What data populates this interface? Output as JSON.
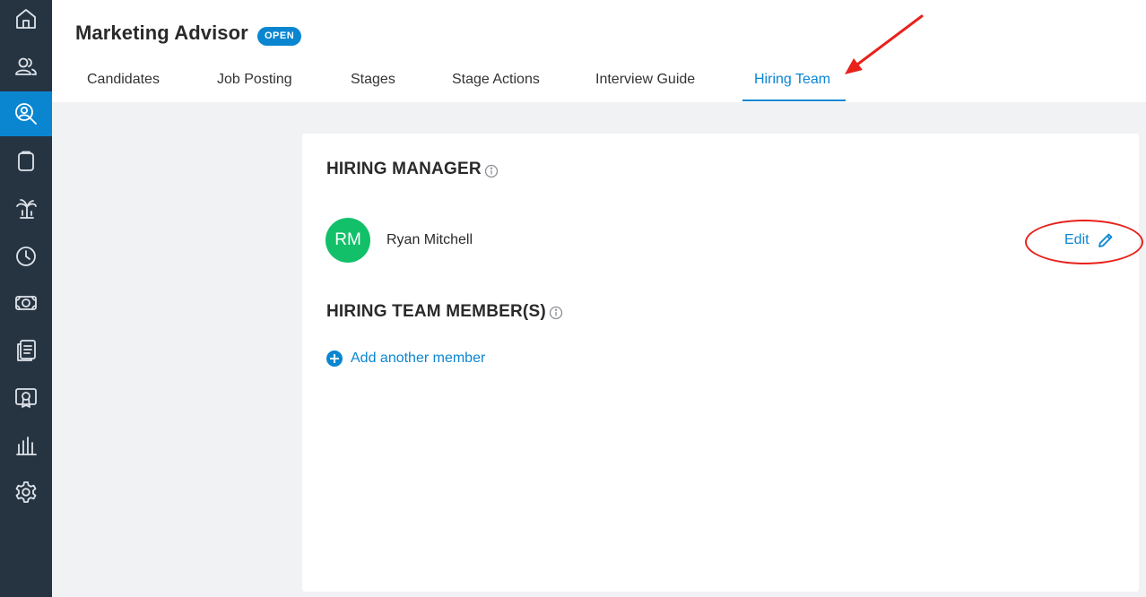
{
  "sidebar": {
    "items": [
      {
        "icon": "home-icon",
        "active": false
      },
      {
        "icon": "people-icon",
        "active": false
      },
      {
        "icon": "recruiting-icon",
        "active": true
      },
      {
        "icon": "clipboard-icon",
        "active": false
      },
      {
        "icon": "palm-tree-icon",
        "active": false
      },
      {
        "icon": "clock-icon",
        "active": false
      },
      {
        "icon": "money-icon",
        "active": false
      },
      {
        "icon": "reports-icon",
        "active": false
      },
      {
        "icon": "certificate-icon",
        "active": false
      },
      {
        "icon": "analytics-icon",
        "active": false
      },
      {
        "icon": "gear-icon",
        "active": false
      }
    ]
  },
  "header": {
    "title": "Marketing Advisor",
    "status": "OPEN"
  },
  "tabs": [
    {
      "label": "Candidates",
      "active": false
    },
    {
      "label": "Job Posting",
      "active": false
    },
    {
      "label": "Stages",
      "active": false
    },
    {
      "label": "Stage Actions",
      "active": false
    },
    {
      "label": "Interview Guide",
      "active": false
    },
    {
      "label": "Hiring Team",
      "active": true
    }
  ],
  "hiring_manager": {
    "title": "HIRING MANAGER",
    "initials": "RM",
    "name": "Ryan Mitchell",
    "edit_label": "Edit"
  },
  "hiring_team": {
    "title": "HIRING TEAM MEMBER(S)",
    "add_label": "Add another member"
  },
  "colors": {
    "sidebar_bg": "#263442",
    "accent": "#0a86d1",
    "avatar_bg": "#12c06a",
    "annotation": "#e8211b"
  }
}
